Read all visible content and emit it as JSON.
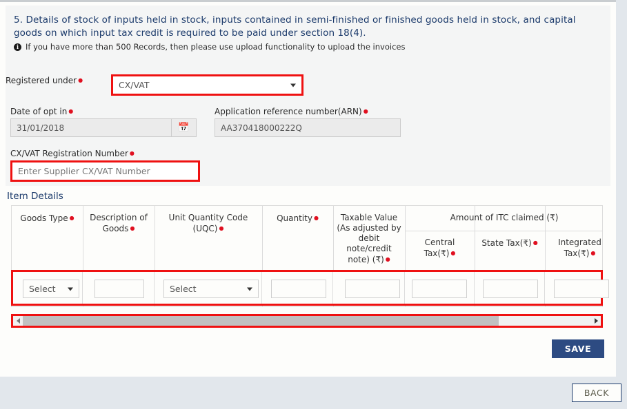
{
  "section": {
    "heading": "5. Details of stock of inputs held in stock, inputs contained in semi-finished or finished goods held in stock, and capital goods on which input tax credit is required to be paid under section 18(4).",
    "info_icon": "info-circle-icon",
    "info_text": "If you have more than 500 Records, then please use upload functionality to upload the invoices"
  },
  "form": {
    "registered_under": {
      "label": "Registered under",
      "value": "CX/VAT",
      "required": true,
      "highlighted": true
    },
    "date_of_opt_in": {
      "label": "Date of opt in",
      "value": "31/01/2018",
      "required": true,
      "calendar_icon": "calendar-icon"
    },
    "arn": {
      "label": "Application reference number(ARN)",
      "value": "AA370418000222Q",
      "required": true
    },
    "registration_number": {
      "label": "CX/VAT Registration Number",
      "value": "",
      "placeholder": "Enter Supplier CX/VAT Number",
      "required": true,
      "highlighted": true
    }
  },
  "item_details": {
    "title": "Item Details",
    "group_header": "Amount of ITC claimed (₹)",
    "columns": [
      {
        "label": "Goods Type",
        "required": true
      },
      {
        "label": "Description of Goods",
        "required": true
      },
      {
        "label": "Unit Quantity Code (UQC)",
        "required": true
      },
      {
        "label": "Quantity",
        "required": true
      },
      {
        "label": "Taxable Value (As adjusted by debit note/credit note) (₹)",
        "required": true
      },
      {
        "label": "Central Tax(₹)",
        "required": true
      },
      {
        "label": "State Tax(₹)",
        "required": true
      },
      {
        "label": "Integrated Tax(₹)",
        "required": true
      }
    ],
    "row": {
      "goods_type": "Select",
      "description": "",
      "uqc": "Select",
      "quantity": "",
      "taxable_value": "",
      "central_tax": "",
      "state_tax": "",
      "integrated_tax": ""
    }
  },
  "scrollbar": {
    "left_arrow_icon": "scroll-left-arrow-icon",
    "right_arrow_icon": "scroll-right-arrow-icon",
    "orientation": "horizontal",
    "highlighted": true
  },
  "actions": {
    "save_label": "SAVE",
    "back_label": "BACK"
  },
  "colors": {
    "heading_blue": "#1b3a6b",
    "required_red": "#e01020",
    "highlight_red": "#ef1111",
    "save_blue": "#2d4b82",
    "panel_grey": "#f4f5f5",
    "footer_grey": "#e2e7ec"
  }
}
